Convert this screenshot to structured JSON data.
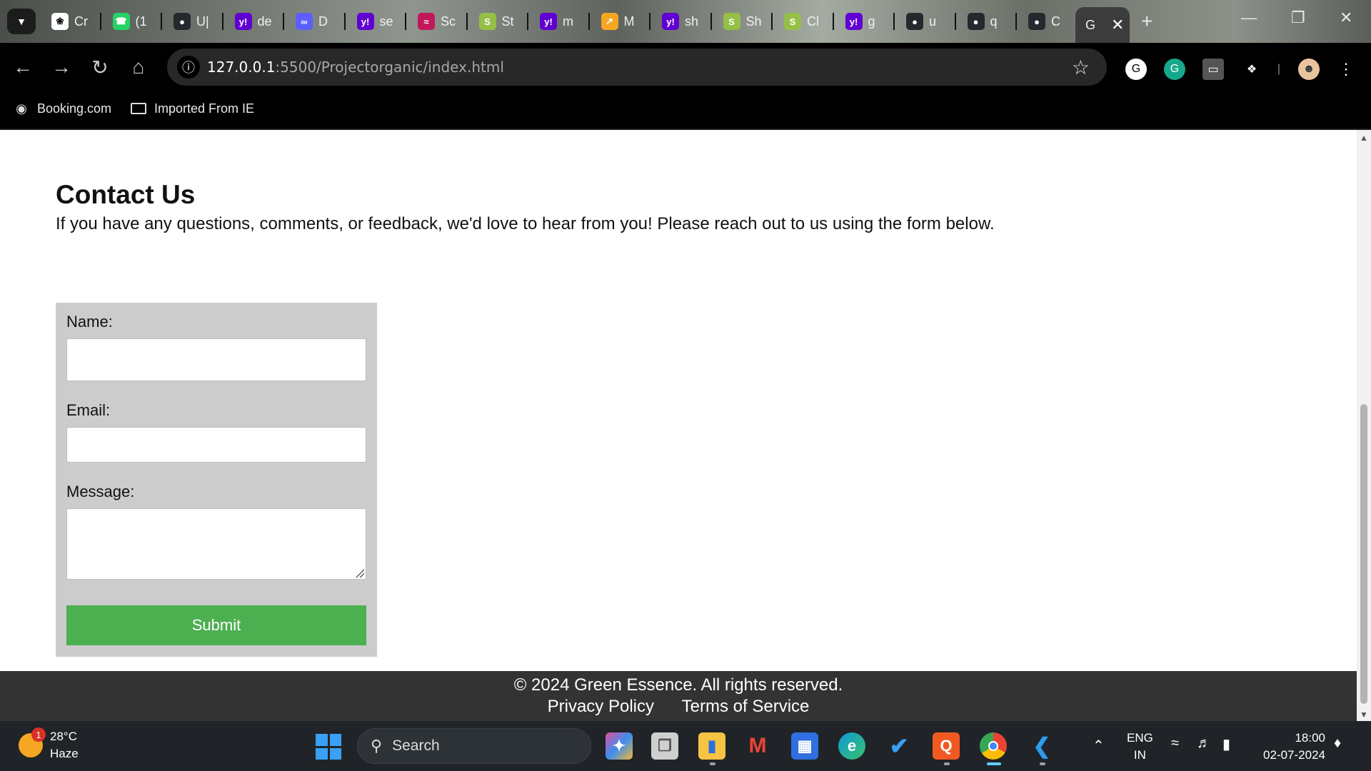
{
  "browser": {
    "tabs": [
      {
        "title": "Cr",
        "icon": "chatgpt-icon",
        "color": "#ffffff"
      },
      {
        "title": "(1",
        "icon": "whatsapp-icon",
        "color": "#25d366"
      },
      {
        "title": "U|",
        "icon": "github-icon",
        "color": "#24292e"
      },
      {
        "title": "de",
        "icon": "yahoo-icon",
        "color": "#6001d2"
      },
      {
        "title": "D",
        "icon": "meta-icon",
        "color": "#5b5fff"
      },
      {
        "title": "se",
        "icon": "yahoo-icon",
        "color": "#6001d2"
      },
      {
        "title": "Sc",
        "icon": "stripe-icon",
        "color": "#c2185b"
      },
      {
        "title": "St",
        "icon": "shopify-icon",
        "color": "#95bf47"
      },
      {
        "title": "m",
        "icon": "yahoo-icon",
        "color": "#6001d2"
      },
      {
        "title": "M",
        "icon": "miro-icon",
        "color": "#f5a623"
      },
      {
        "title": "sh",
        "icon": "yahoo-icon",
        "color": "#6001d2"
      },
      {
        "title": "Sh",
        "icon": "shopify-icon",
        "color": "#95bf47"
      },
      {
        "title": "Cl",
        "icon": "shopify-icon",
        "color": "#95bf47"
      },
      {
        "title": "g",
        "icon": "yahoo-icon",
        "color": "#6001d2"
      },
      {
        "title": "u",
        "icon": "github-icon",
        "color": "#24292e"
      },
      {
        "title": "q",
        "icon": "github-icon",
        "color": "#24292e"
      },
      {
        "title": "C",
        "icon": "github-icon",
        "color": "#24292e"
      }
    ],
    "active_tab": {
      "title": "G"
    },
    "url_host": "127.0.0.1",
    "url_rest": ":5500/Projectorganic/index.html",
    "bookmarks": [
      {
        "label": "Booking.com",
        "icon": "globe-icon"
      },
      {
        "label": "Imported From IE",
        "icon": "folder-icon"
      }
    ]
  },
  "page": {
    "heading": "Contact Us",
    "lead": "If you have any questions, comments, or feedback, we'd love to hear from you! Please reach out to us using the form below.",
    "form": {
      "name_label": "Name:",
      "name_value": "",
      "email_label": "Email:",
      "email_value": "",
      "message_label": "Message:",
      "message_value": "",
      "submit_label": "Submit"
    },
    "footer": {
      "copyright": "© 2024 Green Essence. All rights reserved.",
      "privacy": "Privacy Policy",
      "terms": "Terms of Service"
    }
  },
  "taskbar": {
    "weather_temp": "28°C",
    "weather_desc": "Haze",
    "weather_badge": "1",
    "search_label": "Search",
    "lang_1": "ENG",
    "lang_2": "IN",
    "time": "18:00",
    "date": "02-07-2024"
  },
  "colors": {
    "submit_bg": "#4caf50",
    "form_bg": "#cccccc",
    "footer_bg": "#333333"
  }
}
